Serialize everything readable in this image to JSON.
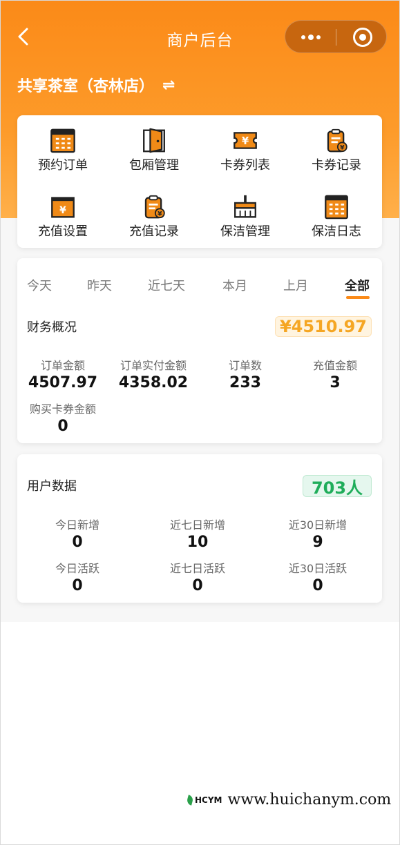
{
  "nav": {
    "title": "商户后台",
    "back_icon": "chevron-left-icon",
    "more_icon": "more-dots-icon",
    "close_icon": "target-close-icon"
  },
  "store": {
    "name": "共享茶室（杏林店）",
    "switch_icon": "⇌"
  },
  "colors": {
    "accent": "#fb8a18",
    "icon_orange": "#f08a17",
    "amount_text": "#f5a623",
    "users_text": "#1fad5a"
  },
  "menu": {
    "items": [
      {
        "label": "预约订单",
        "icon": "calendar-grid-icon"
      },
      {
        "label": "包厢管理",
        "icon": "door-icon"
      },
      {
        "label": "卡券列表",
        "icon": "yen-ticket-icon"
      },
      {
        "label": "卡券记录",
        "icon": "clipboard-yen-icon"
      },
      {
        "label": "充值设置",
        "icon": "yen-wallet-icon"
      },
      {
        "label": "充值记录",
        "icon": "clipboard-yen-icon"
      },
      {
        "label": "保洁管理",
        "icon": "broom-icon"
      },
      {
        "label": "保洁日志",
        "icon": "log-grid-icon"
      }
    ]
  },
  "finance": {
    "tabs": [
      "今天",
      "昨天",
      "近七天",
      "本月",
      "上月",
      "全部"
    ],
    "active_tab": "全部",
    "title": "财务概况",
    "total": "¥4510.97",
    "stats": [
      {
        "label": "订单金额",
        "value": "4507.97"
      },
      {
        "label": "订单实付金额",
        "value": "4358.02"
      },
      {
        "label": "订单数",
        "value": "233"
      },
      {
        "label": "充值金额",
        "value": "3"
      },
      {
        "label": "购买卡券金额",
        "value": "0"
      }
    ]
  },
  "users": {
    "title": "用户数据",
    "total": "703人",
    "stats": [
      {
        "label": "今日新增",
        "value": "0"
      },
      {
        "label": "近七日新增",
        "value": "10"
      },
      {
        "label": "近30日新增",
        "value": "9"
      },
      {
        "label": "今日活跃",
        "value": "0"
      },
      {
        "label": "近七日活跃",
        "value": "0"
      },
      {
        "label": "近30日活跃",
        "value": "0"
      }
    ]
  },
  "watermark": {
    "logo": "HCYM",
    "url": "www.huichanym.com"
  }
}
